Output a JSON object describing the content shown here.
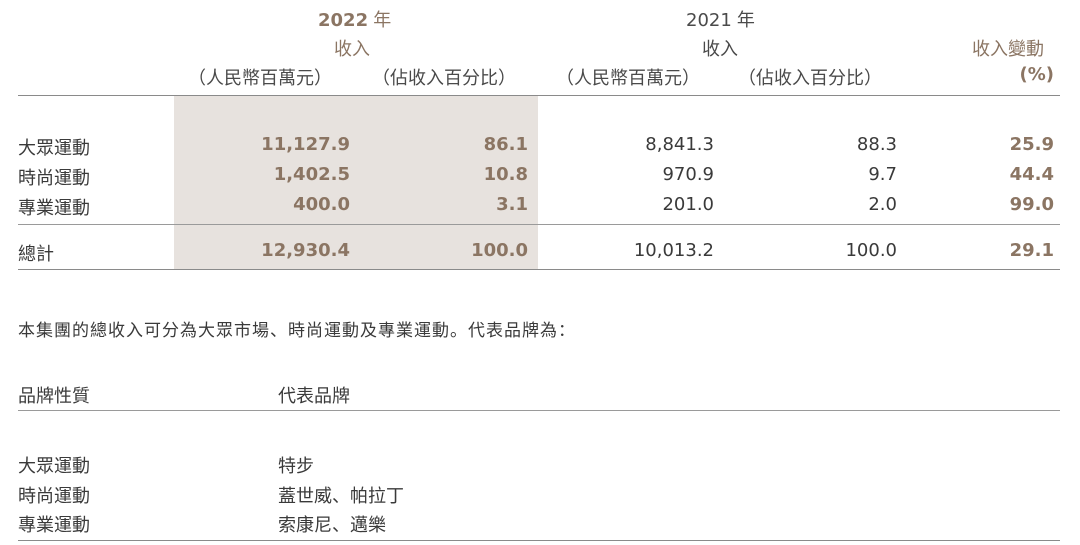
{
  "table1": {
    "year_2022": "2022",
    "year_suffix": "年",
    "year_2021": "2021",
    "revenue_label": "收入",
    "change_label": "收入變動",
    "unit_rmb": "（人民幣百萬元）",
    "unit_pct": "（佔收入百分比）",
    "unit_pct_change": "(%)",
    "rows": [
      {
        "name": "大眾運動",
        "rev_2022": "11,127.9",
        "pct_2022": "86.1",
        "rev_2021": "8,841.3",
        "pct_2021": "88.3",
        "change": "25.9"
      },
      {
        "name": "時尚運動",
        "rev_2022": "1,402.5",
        "pct_2022": "10.8",
        "rev_2021": "970.9",
        "pct_2021": "9.7",
        "change": "44.4"
      },
      {
        "name": "專業運動",
        "rev_2022": "400.0",
        "pct_2022": "3.1",
        "rev_2021": "201.0",
        "pct_2021": "2.0",
        "change": "99.0"
      }
    ],
    "total": {
      "name": "總計",
      "rev_2022": "12,930.4",
      "pct_2022": "100.0",
      "rev_2021": "10,013.2",
      "pct_2021": "100.0",
      "change": "29.1"
    }
  },
  "sentence": "本集團的總收入可分為大眾市場、時尚運動及專業運動。代表品牌為：",
  "table2": {
    "col1": "品牌性質",
    "col2": "代表品牌",
    "rows": [
      {
        "type": "大眾運動",
        "brands": "特步"
      },
      {
        "type": "時尚運動",
        "brands": "蓋世威、帕拉丁"
      },
      {
        "type": "專業運動",
        "brands": "索康尼、邁樂"
      }
    ]
  },
  "colors": {
    "accent": "#8b7563",
    "highlight": "#e7e2de",
    "text": "#3a3a3a",
    "rule": "#8a8a8a"
  }
}
